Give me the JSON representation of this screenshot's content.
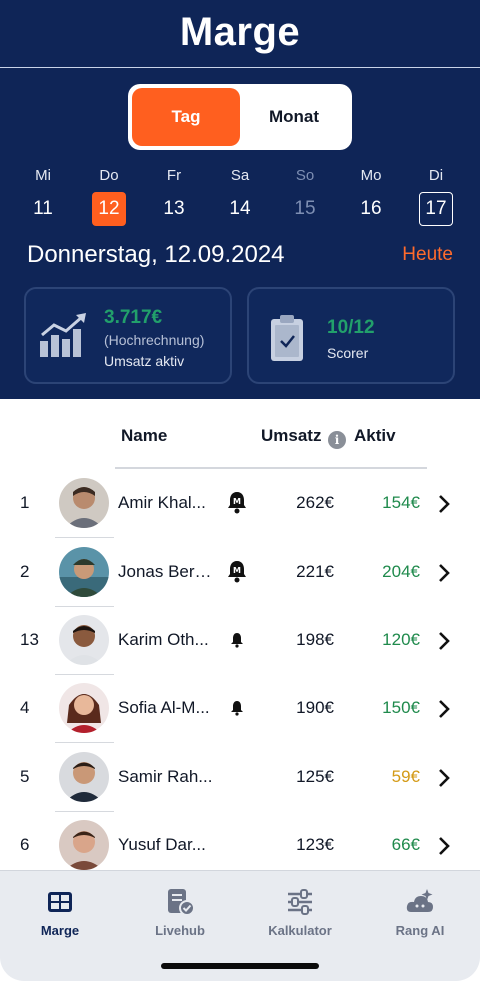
{
  "header": {
    "title": "Marge"
  },
  "segment": {
    "options": [
      "Tag",
      "Monat"
    ],
    "active": "Tag"
  },
  "days": [
    {
      "name": "Mi",
      "num": "11"
    },
    {
      "name": "Do",
      "num": "12"
    },
    {
      "name": "Fr",
      "num": "13"
    },
    {
      "name": "Sa",
      "num": "14"
    },
    {
      "name": "So",
      "num": "15"
    },
    {
      "name": "Mo",
      "num": "16"
    },
    {
      "name": "Di",
      "num": "17"
    }
  ],
  "date_row": {
    "label": "Donnerstag, 12.09.2024",
    "today_link": "Heute"
  },
  "cards": {
    "revenue": {
      "value": "3.717€",
      "sub": "(Hochrechnung)",
      "label": "Umsatz aktiv"
    },
    "scorer": {
      "value": "10/12",
      "label": "Scorer"
    }
  },
  "table": {
    "headers": {
      "name": "Name",
      "umsatz": "Umsatz",
      "aktiv": "Aktiv"
    },
    "rows": [
      {
        "rank": "1",
        "name": "Amir Khal...",
        "bell": "bell-m",
        "umsatz": "262€",
        "aktiv": "154€",
        "aktiv_color": "#1f8a4c"
      },
      {
        "rank": "2",
        "name": "Jonas Berg...",
        "bell": "bell-m",
        "umsatz": "221€",
        "aktiv": "204€",
        "aktiv_color": "#1f8a4c"
      },
      {
        "rank": "13",
        "name": "Karim Oth...",
        "bell": "bell-small",
        "umsatz": "198€",
        "aktiv": "120€",
        "aktiv_color": "#1f8a4c"
      },
      {
        "rank": "4",
        "name": "Sofia Al-M...",
        "bell": "bell-small",
        "umsatz": "190€",
        "aktiv": "150€",
        "aktiv_color": "#1f8a4c"
      },
      {
        "rank": "5",
        "name": "Samir Rah...",
        "bell": "",
        "umsatz": "125€",
        "aktiv": "59€",
        "aktiv_color": "#d49a16"
      },
      {
        "rank": "6",
        "name": "Yusuf Dar...",
        "bell": "",
        "umsatz": "123€",
        "aktiv": "66€",
        "aktiv_color": "#1f8a4c"
      }
    ]
  },
  "bottom_nav": {
    "items": [
      {
        "label": "Marge",
        "icon": "grid-icon"
      },
      {
        "label": "Livehub",
        "icon": "document-check-icon"
      },
      {
        "label": "Kalkulator",
        "icon": "sliders-icon"
      },
      {
        "label": "Rang AI",
        "icon": "cloud-sparkle-icon"
      }
    ]
  },
  "colors": {
    "navy": "#0f2557",
    "accent": "#ff5f1f",
    "green": "#1f8a4c",
    "amber": "#d49a16"
  }
}
